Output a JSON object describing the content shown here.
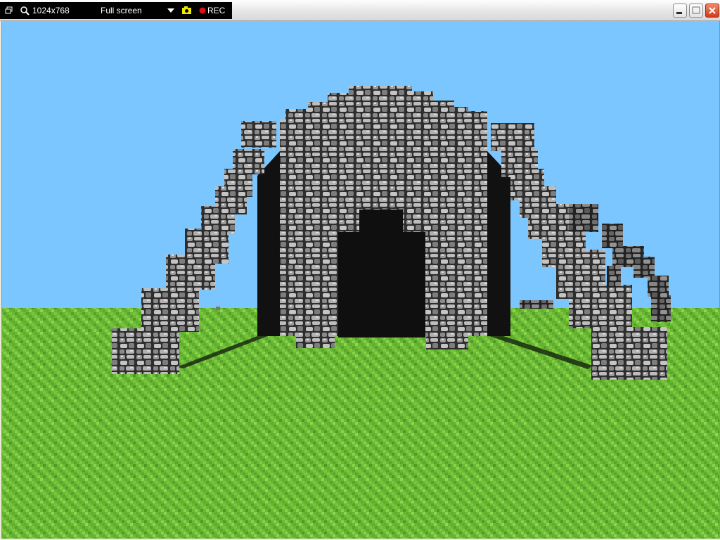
{
  "recorder": {
    "resolution": "1024x768",
    "mode": "Full screen",
    "rec_label": "REC"
  },
  "colors": {
    "sky": "#7cc6ff",
    "grass_light": "#7fcb3e",
    "grass_dark": "#4d9a24",
    "cobble_light": "#b9b9b9",
    "cobble_mid": "#7a7a7a",
    "cobble_dark": "#2e2e2e",
    "shadow": "#111111",
    "rec_red": "#e11111",
    "camera_yellow": "#f1e600"
  },
  "icons": [
    "window-restore-icon",
    "zoom-icon",
    "dropdown-arrow-icon",
    "camera-icon",
    "record-dot-icon",
    "minimize-icon",
    "maximize-icon",
    "close-icon"
  ]
}
